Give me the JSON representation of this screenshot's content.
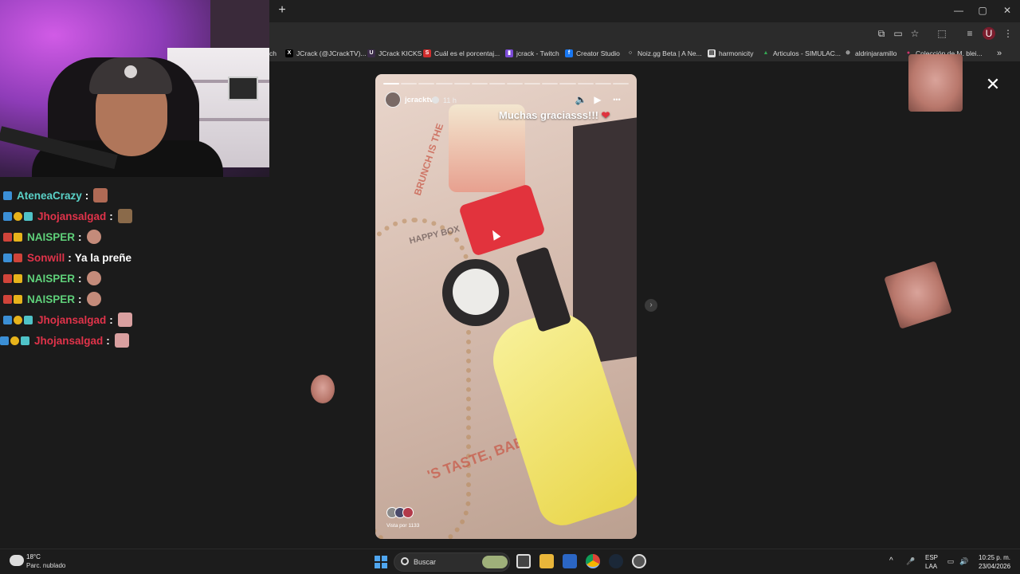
{
  "browser": {
    "new_tab_symbol": "+",
    "window_controls": [
      "—",
      "▢",
      "✕"
    ],
    "bookmarks": [
      {
        "label": "ch",
        "color": "#2b2b2b",
        "glyph": ""
      },
      {
        "label": "JCrack (@JCrackTV)...",
        "color": "#000000",
        "glyph": "X"
      },
      {
        "label": "JCrack KICKS",
        "color": "#3a2b47",
        "glyph": "U"
      },
      {
        "label": "Cuál es el porcentaj...",
        "color": "#d12d2d",
        "glyph": "S"
      },
      {
        "label": "jcrack - Twitch",
        "color": "#7b4bd6",
        "glyph": "▮"
      },
      {
        "label": "Creator Studio",
        "color": "#1877f2",
        "glyph": "f"
      },
      {
        "label": "Noiz.gg Beta | A Ne...",
        "color": "#2b2b2b",
        "glyph": "○"
      },
      {
        "label": "harmonicity",
        "color": "#dddddd",
        "glyph": "▤"
      },
      {
        "label": "Articulos - SIMULAC...",
        "color": "#34a853",
        "glyph": "▲"
      },
      {
        "label": "aldrinjaramillo",
        "color": "#888888",
        "glyph": "⊕"
      },
      {
        "label": "Colección de M. blei...",
        "color": "#d1336b",
        "glyph": "●"
      }
    ],
    "overflow_symbol": "»"
  },
  "chat": {
    "messages": [
      {
        "user": "AteneaCrazy",
        "user_color": "#5ad1c7",
        "text": "",
        "badges": [
          "#3b8fd6"
        ]
      },
      {
        "user": "Jhojansalgad",
        "user_color": "#e0334a",
        "text": "",
        "badges": [
          "#3b8fd6",
          "#e7b31b",
          "#4fc3c8"
        ]
      },
      {
        "user": "NAISPER",
        "user_color": "#5fd17a",
        "text": "",
        "badges": [
          "#d0443a",
          "#e7b31b"
        ]
      },
      {
        "user": "Sonwill",
        "user_color": "#e0334a",
        "text": "Ya la preñe",
        "badges": [
          "#3b8fd6",
          "#d0443a"
        ]
      },
      {
        "user": "NAISPER",
        "user_color": "#5fd17a",
        "text": "",
        "badges": [
          "#d0443a",
          "#e7b31b"
        ]
      },
      {
        "user": "NAISPER",
        "user_color": "#5fd17a",
        "text": "",
        "badges": [
          "#d0443a",
          "#e7b31b"
        ]
      },
      {
        "user": "Jhojansalgad",
        "user_color": "#e0334a",
        "text": "",
        "badges": [
          "#3b8fd6",
          "#e7b31b",
          "#4fc3c8"
        ]
      },
      {
        "user": "Jhojansalgad",
        "user_color": "#e0334a",
        "text": "",
        "badges": [
          "#3b8fd6",
          "#e7b31b",
          "#4fc3c8"
        ]
      }
    ]
  },
  "story": {
    "username": "jcracktv",
    "time_ago": "11 h",
    "caption": "Muchas graciasss!!!",
    "caption_emoji": "❤",
    "viewed_by": "Vista por 1133",
    "segments": 14,
    "controls": {
      "mute": "🔈",
      "play": "▶",
      "more": "•••"
    },
    "tray_text_1": "HAPPY BOX",
    "tray_text_2": "'S TASTE, BABY",
    "tray_text_3": "BRUNCH IS THE"
  },
  "viewer": {
    "close_symbol": "✕",
    "next_symbol": "›"
  },
  "taskbar": {
    "weather_temp": "18°C",
    "weather_condition": "Parc. nublado",
    "search_label": "Buscar",
    "lang_top": "ESP",
    "lang_bottom": "LAA",
    "time": "10:25 p. m.",
    "date": "23/04/2026",
    "tray_chevron": "^",
    "tray_icons": [
      "🎤",
      "▭",
      "🔊"
    ]
  },
  "colors": {
    "accent": "#4fa6f0",
    "heart": "#e0333e"
  }
}
